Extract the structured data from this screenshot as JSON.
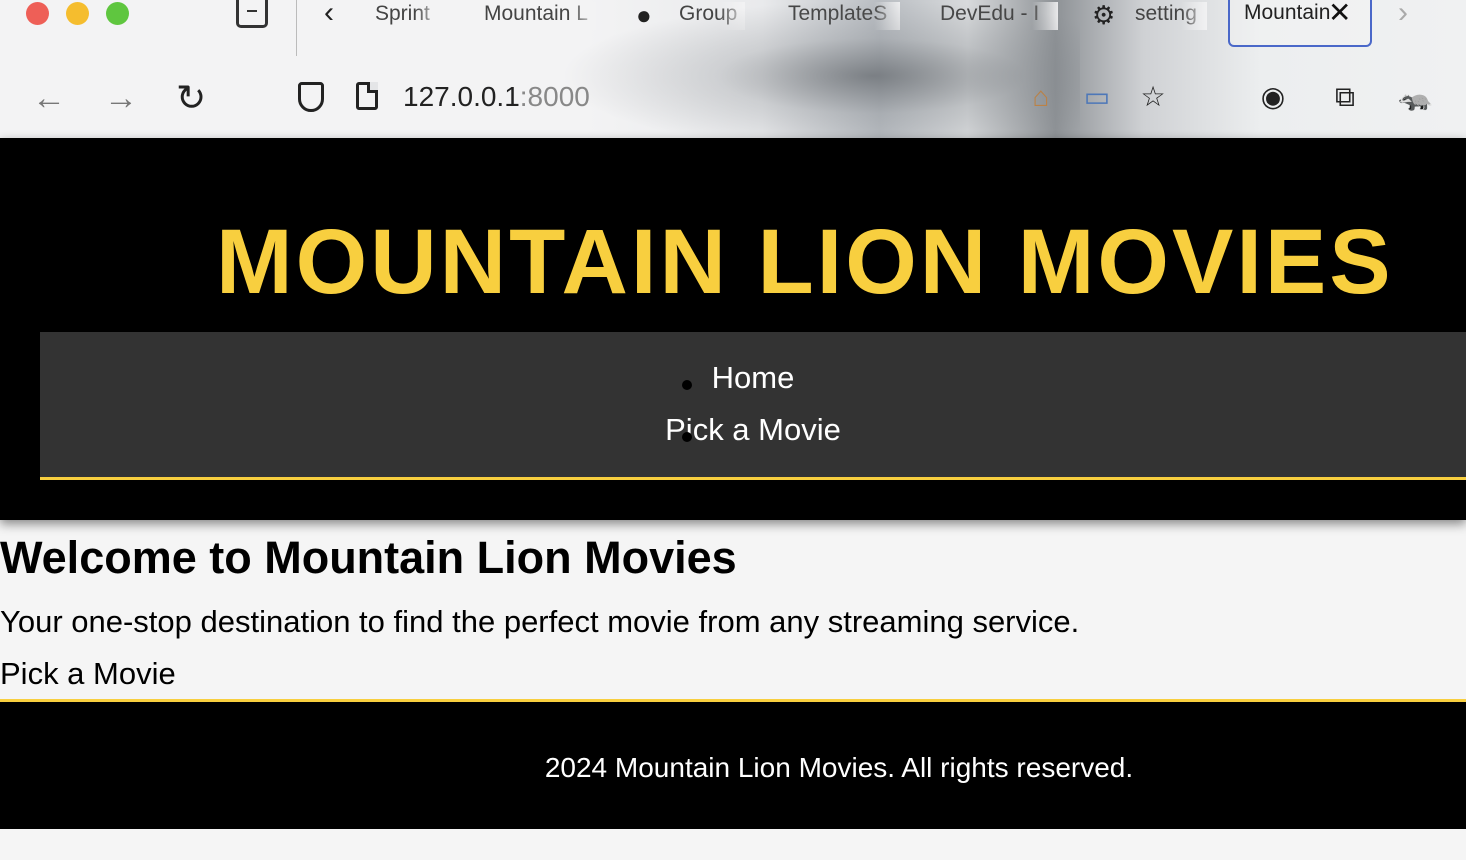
{
  "browser": {
    "tabs": [
      {
        "label": "Sprint"
      },
      {
        "label": "Mountain L"
      },
      {
        "label": "Group"
      },
      {
        "label": "TemplateS"
      },
      {
        "label": "DevEdu - I"
      },
      {
        "label": "setting"
      }
    ],
    "active_tab": {
      "label": "Mountain Lion Movies"
    },
    "url_host": "127.0.0.1",
    "url_port": ":8000",
    "icons": {
      "back": "←",
      "forward": "→",
      "reload": "↻",
      "close": "✕",
      "prev": "‹",
      "next": "›",
      "star": "☆",
      "home": "⌂",
      "screen": "▭",
      "account": "◉",
      "puzzle": "⧉",
      "badger": "🦡",
      "github": "●",
      "settings": "⚙"
    }
  },
  "header": {
    "title": "MOUNTAIN LION MOVIES",
    "nav": [
      {
        "label": "Home"
      },
      {
        "label": "Pick a Movie"
      }
    ]
  },
  "main": {
    "heading": "Welcome to Mountain Lion Movies",
    "tagline": "Your one-stop destination to find the perfect movie from any streaming service.",
    "link": "Pick a Movie"
  },
  "footer": {
    "text": "2024 Mountain Lion Movies. All rights reserved."
  },
  "colors": {
    "accent": "#f8cf3f",
    "header_bg": "#000000",
    "nav_bg": "#333333",
    "page_bg": "#f5f5f5"
  }
}
